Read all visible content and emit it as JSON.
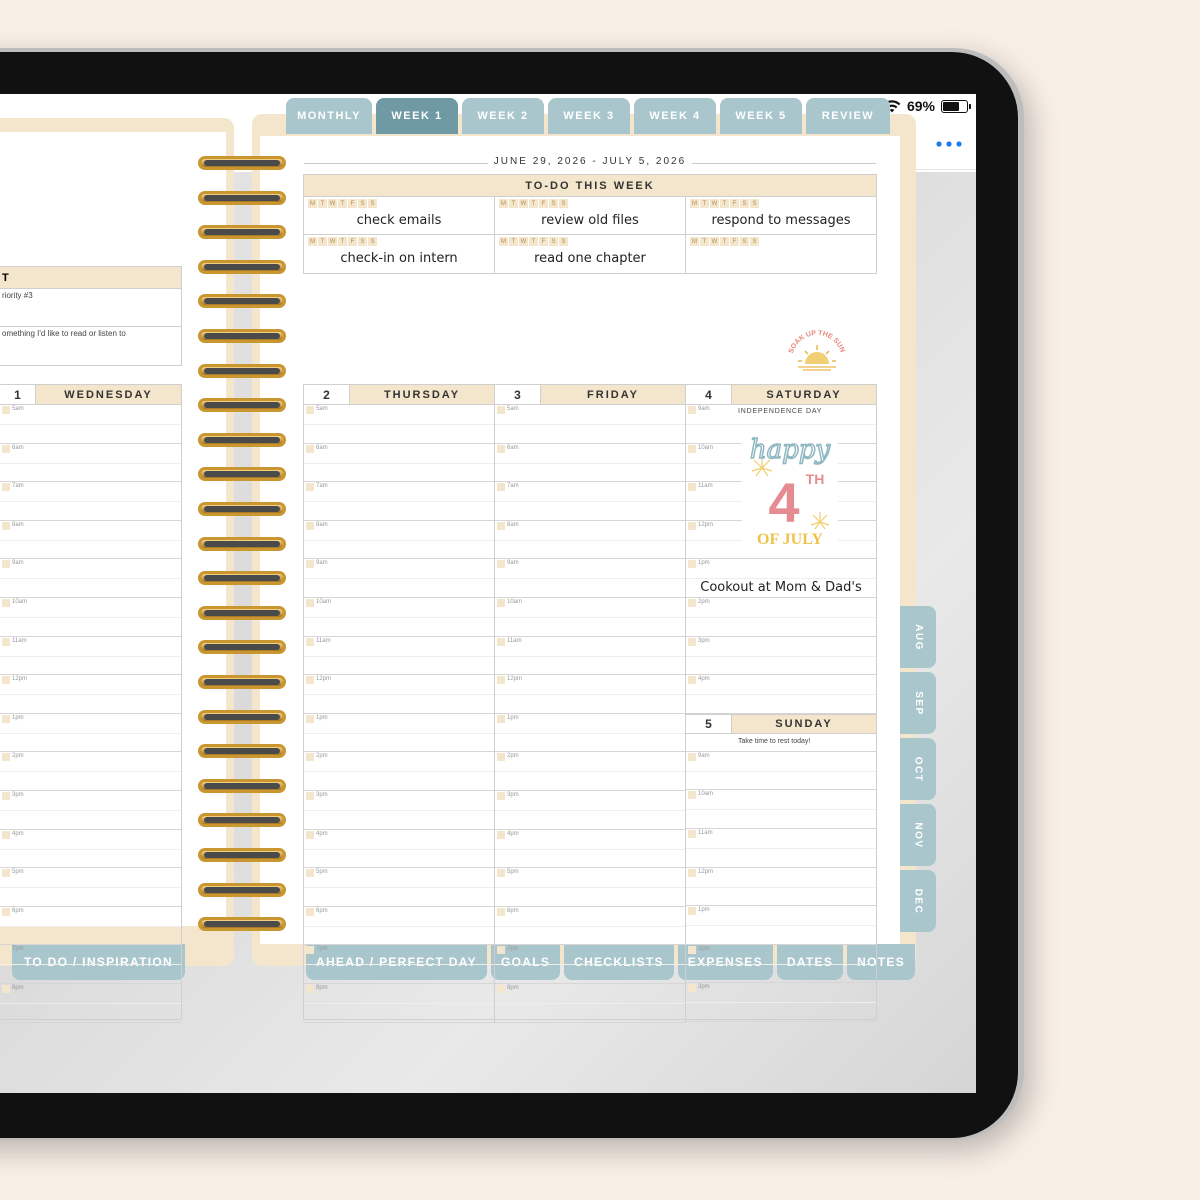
{
  "status": {
    "battery": "69%"
  },
  "top_tabs": [
    {
      "label": "MONTHLY"
    },
    {
      "label": "WEEK 1"
    },
    {
      "label": "WEEK 2"
    },
    {
      "label": "WEEK 3"
    },
    {
      "label": "WEEK 4"
    },
    {
      "label": "WEEK 5"
    },
    {
      "label": "REVIEW"
    }
  ],
  "side_tabs": [
    {
      "label": "AUG"
    },
    {
      "label": "SEP"
    },
    {
      "label": "OCT"
    },
    {
      "label": "NOV"
    },
    {
      "label": "DEC"
    }
  ],
  "bottom_tabs_left": "TO DO / INSPIRATION",
  "bottom_tabs": [
    {
      "label": "AHEAD / PERFECT DAY"
    },
    {
      "label": "GOALS"
    },
    {
      "label": "CHECKLISTS"
    },
    {
      "label": "EXPENSES"
    },
    {
      "label": "DATES"
    },
    {
      "label": "NOTES"
    }
  ],
  "left_page": {
    "header": "T",
    "rows": [
      "riority #3",
      "omething I'd like to read or listen to"
    ],
    "day_number": "1",
    "day_name": "WEDNESDAY",
    "times": [
      "5am",
      "6am",
      "7am",
      "8am",
      "9am",
      "10am",
      "11am",
      "12pm",
      "1pm",
      "2pm",
      "3pm",
      "4pm",
      "5pm",
      "6pm",
      "7pm",
      "8pm"
    ]
  },
  "date_range": "JUNE 29, 2026 - JULY 5, 2026",
  "todo": {
    "title": "TO-DO THIS WEEK",
    "weekday_letters": [
      "M",
      "T",
      "W",
      "T",
      "F",
      "S",
      "S"
    ],
    "items": [
      "check emails",
      "review old files",
      "respond to messages",
      "check-in on intern",
      "read one chapter",
      ""
    ]
  },
  "sticker_sun": "SOAK UP THE SUN",
  "days": [
    {
      "number": "2",
      "name": "THURSDAY",
      "times": [
        "5am",
        "6am",
        "7am",
        "8am",
        "9am",
        "10am",
        "11am",
        "12pm",
        "1pm",
        "2pm",
        "3pm",
        "4pm",
        "5pm",
        "6pm",
        "7pm",
        "8pm"
      ]
    },
    {
      "number": "3",
      "name": "FRIDAY",
      "times": [
        "5am",
        "6am",
        "7am",
        "8am",
        "9am",
        "10am",
        "11am",
        "12pm",
        "1pm",
        "2pm",
        "3pm",
        "4pm",
        "5pm",
        "6pm",
        "7pm",
        "8pm"
      ]
    }
  ],
  "saturday": {
    "number": "4",
    "name": "SATURDAY",
    "holiday": "INDEPENDENCE DAY",
    "times": [
      "9am",
      "10am",
      "11am",
      "12pm",
      "1pm",
      "2pm",
      "3pm",
      "4pm"
    ],
    "sticker_lines": [
      "happy",
      "4",
      "TH",
      "OF JULY"
    ],
    "event": "Cookout at Mom & Dad's"
  },
  "sunday": {
    "number": "5",
    "name": "SUNDAY",
    "note": "Take time to rest today!",
    "times": [
      "9am",
      "10am",
      "11am",
      "12pm",
      "1pm",
      "2pm",
      "3pm"
    ]
  },
  "colors": {
    "tab": "#a9c6cc",
    "tab_active": "#6f9aa3",
    "cream": "#f4e6cd",
    "accent": "#1b7cf2"
  }
}
